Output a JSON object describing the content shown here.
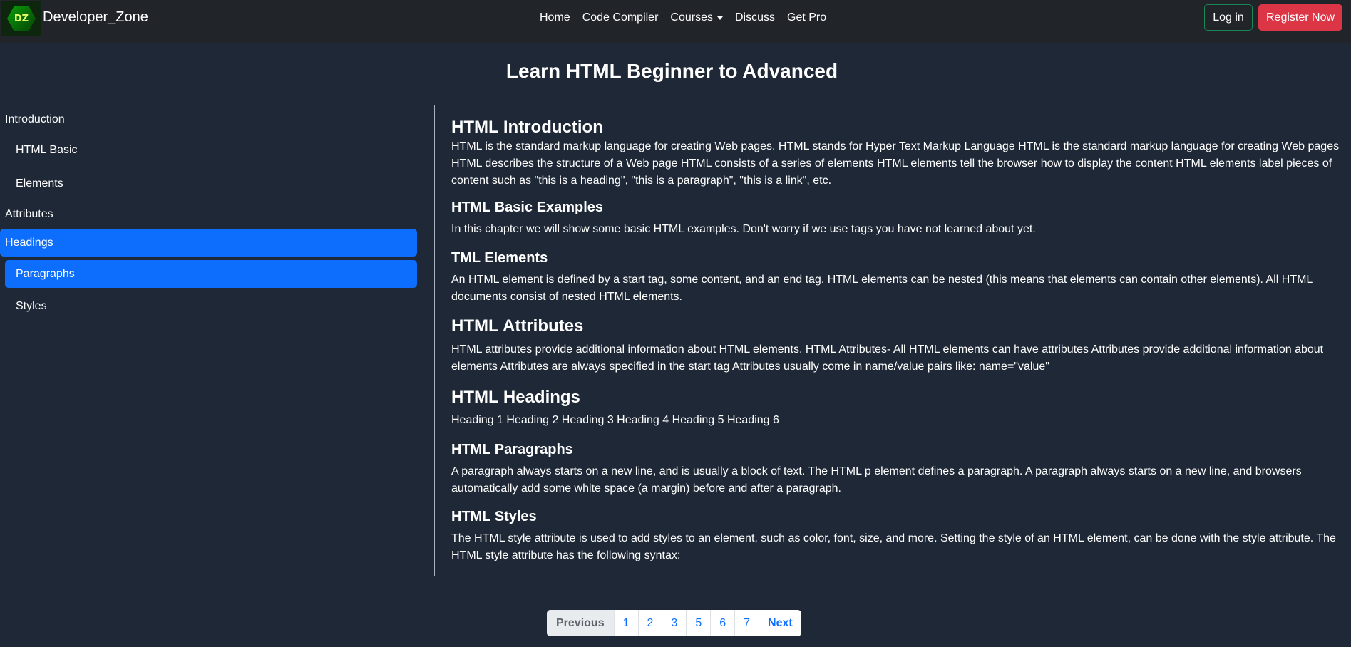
{
  "navbar": {
    "logo_text": "DZ",
    "brand": "Developer_Zone",
    "links": [
      "Home",
      "Code Compiler",
      "Courses",
      "Discuss",
      "Get Pro"
    ],
    "login": "Log in",
    "register": "Register Now",
    "colors": {
      "bg": "#212529",
      "register": "#dc3545",
      "login_border": "#198754"
    }
  },
  "page": {
    "title": "Learn HTML Beginner to Advanced"
  },
  "sidebar": {
    "items": [
      {
        "label": "Introduction",
        "active": false,
        "indent": false
      },
      {
        "label": "HTML Basic",
        "active": false,
        "indent": true
      },
      {
        "label": "Elements",
        "active": false,
        "indent": true
      },
      {
        "label": "Attributes",
        "active": false,
        "indent": false
      },
      {
        "label": "Headings",
        "active": true,
        "indent": false
      },
      {
        "label": "Paragraphs",
        "active": true,
        "indent": true
      },
      {
        "label": "Styles",
        "active": false,
        "indent": true
      }
    ],
    "active_color": "#0d6efd"
  },
  "content": {
    "sections": [
      {
        "title": "HTML Introduction",
        "body": "HTML is the standard markup language for creating Web pages. HTML stands for Hyper Text Markup Language HTML is the standard markup language for creating Web pages HTML describes the structure of a Web page HTML consists of a series of elements HTML elements tell the browser how to display the content HTML elements label pieces of content such as \"this is a heading\", \"this is a paragraph\", \"this is a link\", etc."
      },
      {
        "title": "HTML Basic Examples",
        "body": "In this chapter we will show some basic HTML examples. Don't worry if we use tags you have not learned about yet."
      },
      {
        "title": "TML Elements",
        "body": "An HTML element is defined by a start tag, some content, and an end tag. HTML elements can be nested (this means that elements can contain other elements). All HTML documents consist of nested HTML elements."
      },
      {
        "title": "HTML Attributes",
        "body": "HTML attributes provide additional information about HTML elements. HTML Attributes- All HTML elements can have attributes Attributes provide additional information about elements Attributes are always specified in the start tag Attributes usually come in name/value pairs like: name=\"value\""
      },
      {
        "title": "HTML Headings",
        "body": "Heading 1 Heading 2 Heading 3 Heading 4 Heading 5 Heading 6"
      },
      {
        "title": "HTML Paragraphs",
        "body": "A paragraph always starts on a new line, and is usually a block of text. The HTML p element defines a paragraph. A paragraph always starts on a new line, and browsers automatically add some white space (a margin) before and after a paragraph."
      },
      {
        "title": "HTML Styles",
        "body": "The HTML style attribute is used to add styles to an element, such as color, font, size, and more. Setting the style of an HTML element, can be done with the style attribute. The HTML style attribute has the following syntax:"
      }
    ]
  },
  "pagination": {
    "previous": "Previous",
    "pages": [
      "1",
      "2",
      "3",
      "5",
      "6",
      "7"
    ],
    "next": "Next"
  }
}
